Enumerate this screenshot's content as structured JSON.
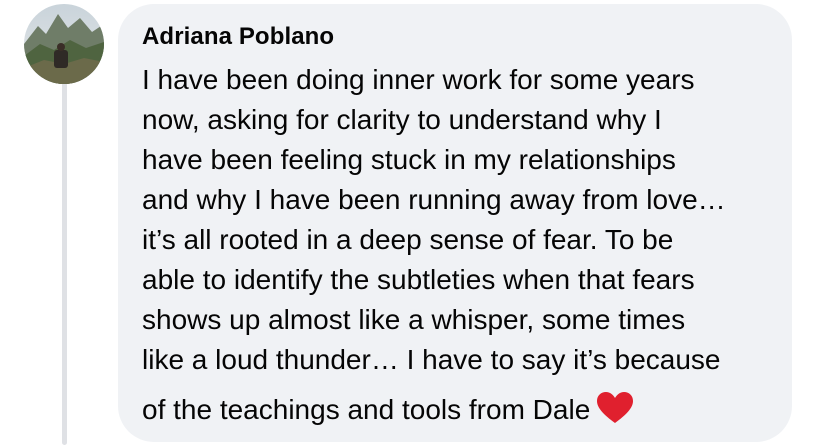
{
  "comment": {
    "author": "Adriana Poblano",
    "lines": [
      "I have been doing inner work for some years",
      "now, asking for clarity to understand why I",
      "have been feeling stuck in my relationships",
      "and why I have been running away from love…",
      "it’s all rooted in a deep sense of fear. To be",
      "able to identify the subtleties when that fears",
      "shows up almost like a whisper, some times",
      "like a loud thunder… I have to say it’s because",
      "of the teachings and tools from Dale"
    ],
    "emoji": "heart-emoji"
  },
  "colors": {
    "bubble": "#f0f2f5",
    "text": "#050505",
    "heart": "#e0202e",
    "thread_line": "#dfe1e5"
  }
}
